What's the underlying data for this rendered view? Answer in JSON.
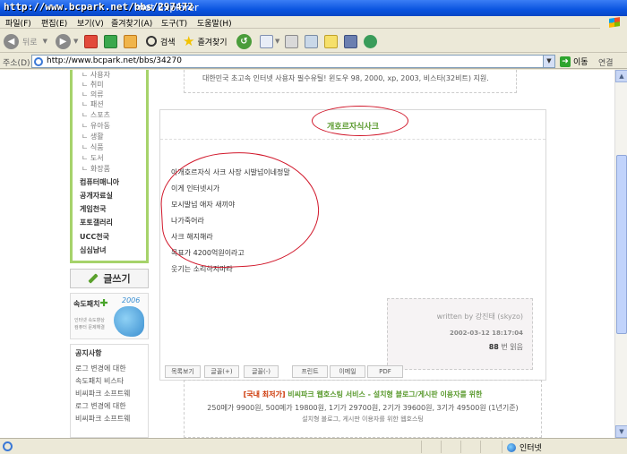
{
  "window": {
    "title_url": "http://www.bcpark.net/bbs/297472",
    "title_suffix": "rnet Explorer"
  },
  "menu": [
    "파일(F)",
    "편집(E)",
    "보기(V)",
    "즐겨찾기(A)",
    "도구(T)",
    "도움말(H)"
  ],
  "toolbar": {
    "back": "뒤로",
    "search": "검색",
    "favorites": "즐겨찾기"
  },
  "address": {
    "label": "주소(D)",
    "url": "http://www.bcpark.net/bbs/34270",
    "go": "이동",
    "links": "연결"
  },
  "sidebar": {
    "sub_categories": [
      "사용자",
      "취미",
      "의류",
      "패션",
      "스포츠",
      "유아동",
      "생활",
      "식품",
      "도서",
      "화장품"
    ],
    "main_categories": [
      "컴퓨터매니아",
      "공개자료실",
      "게임천국",
      "포토갤러리",
      "UCC천국",
      "심심남녀"
    ],
    "write_button": "글쓰기",
    "speed_patch": {
      "title": "속도패치",
      "plus": "✚",
      "year": "2006",
      "desc1": "인터넷 속도향상",
      "desc2": "컴퓨터 문제해결"
    },
    "notice": {
      "title": "공지사항",
      "items": [
        "로그 변경에 대한",
        "속도패치 비스타",
        "비씨파크 소프트웨",
        "로그 변경에 대한",
        "비씨파크 소프트웨"
      ]
    }
  },
  "top_notice": "대한민국 초고속 인터넷 사용자 필수유틸! 윈도우 98, 2000, xp, 2003, 비스타(32비트) 지원.",
  "post": {
    "title": "개호르자식사크",
    "lines": [
      "아개호르자식 사크 사장 시발넘이네정말",
      "이게 인터넷시가",
      "모시발넘 애자 새끼야",
      "나가죽어라",
      "사크 해지해라",
      "목표가 4200억원이라고",
      "웃기는 소리하지마라"
    ],
    "author": "written by 강진태 (skyzo)",
    "date": "2002-03-12 18:17:04",
    "views_count": "88",
    "views_unit": "번 읽음",
    "buttons": [
      "목록보기",
      "글꼴(+)",
      "글꼴(-)",
      "프린트",
      "이메일",
      "PDF"
    ]
  },
  "ad": {
    "prefix": "[국내 최저가]",
    "headline": "비씨파크 웹호스팅 서비스 - 설치형 블로그/게시판 이용자를 위한",
    "prices": "250메가 9900원, 500메가 19800원, 1기가 29700원, 2기가 39600원, 3기가 49500원 (1년기준)",
    "extra": "설치형 블로그, 게시판 이용자를 위한 웹호스팅"
  },
  "status": {
    "zone": "인터넷"
  },
  "colors": {
    "titlebar": "#0a54e0",
    "sidebar_border": "#a6d36b",
    "post_title": "#5a9a2e",
    "annotation_red": "#d1182b"
  }
}
